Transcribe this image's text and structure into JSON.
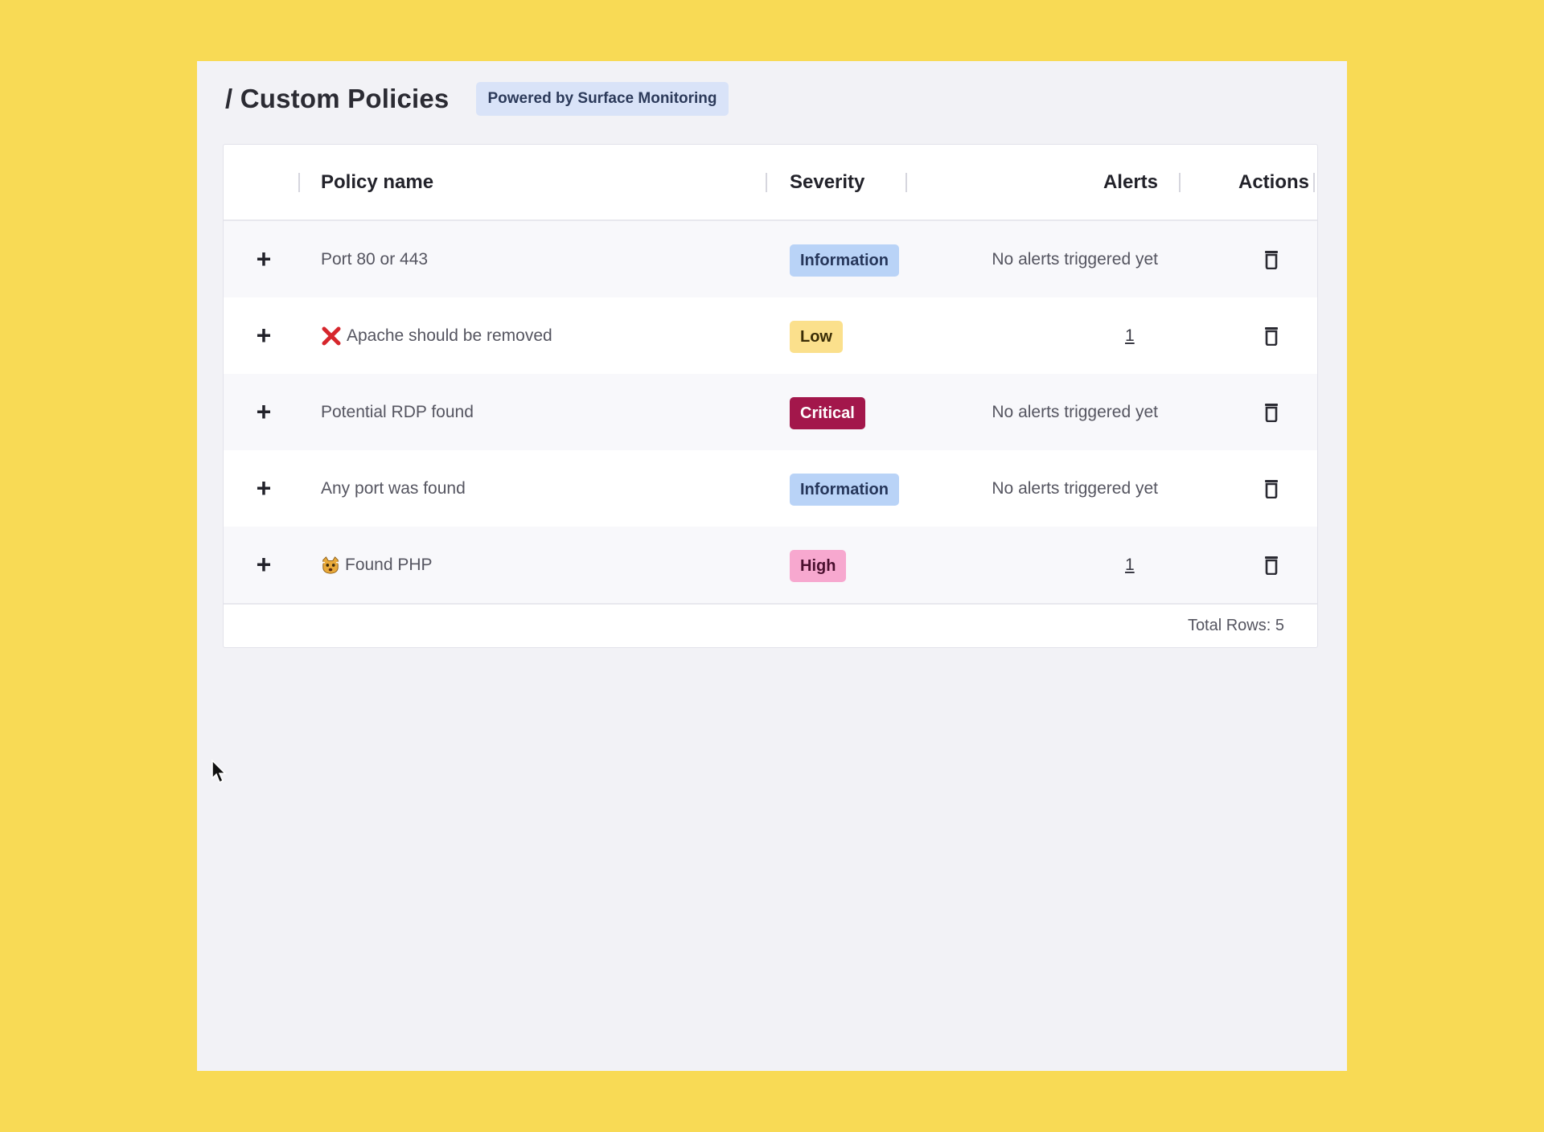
{
  "page": {
    "title": "/ Custom Policies",
    "powered_badge": "Powered by Surface Monitoring"
  },
  "table": {
    "columns": {
      "policy_name": "Policy name",
      "severity": "Severity",
      "alerts": "Alerts",
      "actions": "Actions"
    },
    "expand_symbol": "+",
    "rows": [
      {
        "name": "Port 80 or 443",
        "emoji": "",
        "severity": "Information",
        "alerts": "No alerts triggered yet"
      },
      {
        "name": "Apache should be removed",
        "emoji": "cross-mark-icon",
        "severity": "Low",
        "alerts": "1"
      },
      {
        "name": "Potential RDP found",
        "emoji": "",
        "severity": "Critical",
        "alerts": "No alerts triggered yet"
      },
      {
        "name": "Any port was found",
        "emoji": "",
        "severity": "Information",
        "alerts": "No alerts triggered yet"
      },
      {
        "name": "Found PHP",
        "emoji": "scared-cat-icon",
        "severity": "High",
        "alerts": "1"
      }
    ],
    "footer": {
      "total_rows": "Total Rows: 5"
    }
  },
  "severity_colors": {
    "Information": {
      "bg": "#b9d3f7",
      "fg": "#26365a"
    },
    "Low": {
      "bg": "#fbe08c",
      "fg": "#3a2d06"
    },
    "Critical": {
      "bg": "#a3174b",
      "fg": "#ffffff"
    },
    "High": {
      "bg": "#f7a8cf",
      "fg": "#4a0f2e"
    }
  },
  "colors": {
    "background": "#f8da55",
    "panel": "#f2f2f6",
    "accent_red": "#d6262c"
  }
}
